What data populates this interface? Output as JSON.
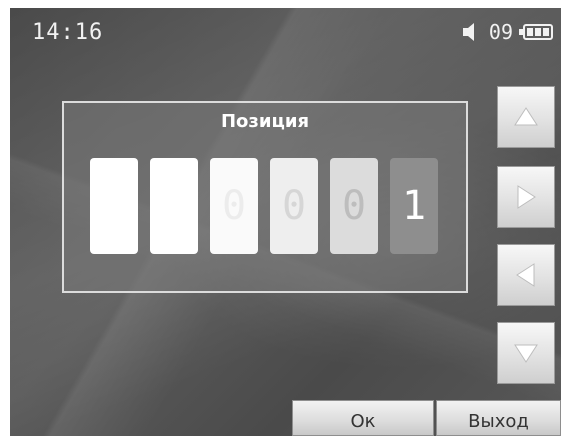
{
  "status_bar": {
    "time": "14:16",
    "volume": "09",
    "icons": [
      "speaker-icon",
      "battery-icon"
    ]
  },
  "dialog": {
    "title": "Позиция",
    "digits": [
      "",
      "",
      "0",
      "0",
      "0",
      "1"
    ]
  },
  "side_buttons": [
    "arrow-up-icon",
    "arrow-right-icon",
    "arrow-left-icon",
    "arrow-down-icon"
  ],
  "buttons": {
    "ok": "Ок",
    "exit": "Выход"
  }
}
